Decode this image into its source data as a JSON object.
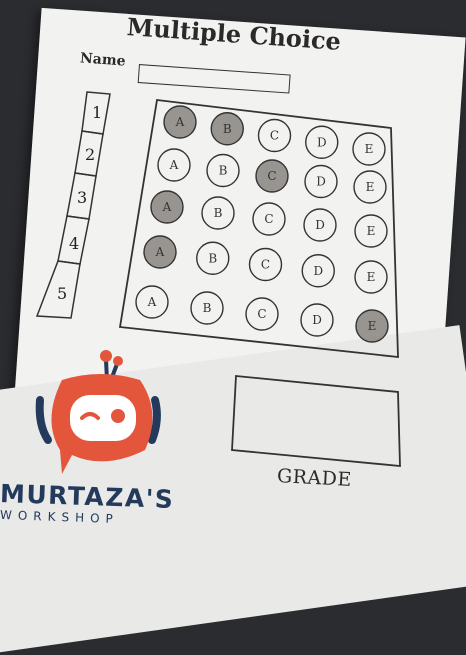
{
  "sheet": {
    "title": "Multiple Choice",
    "name_label": "Name",
    "question_numbers": [
      "1",
      "2",
      "3",
      "4",
      "5"
    ],
    "options": [
      "A",
      "B",
      "C",
      "D",
      "E"
    ],
    "marked": [
      {
        "question": "1",
        "answers": [
          "A",
          "B"
        ]
      },
      {
        "question": "2",
        "answers": [
          "C"
        ]
      },
      {
        "question": "3",
        "answers": [
          "A"
        ]
      },
      {
        "question": "4",
        "answers": [
          "A"
        ]
      },
      {
        "question": "5",
        "answers": [
          "E"
        ]
      }
    ],
    "grade_label": "GRADE"
  },
  "logo": {
    "name": "MURTAZA'S",
    "subtitle": "WORKSHOP",
    "icon": "robot-head-icon",
    "colors": {
      "accent": "#e4563c",
      "navy": "#243a5c"
    }
  }
}
